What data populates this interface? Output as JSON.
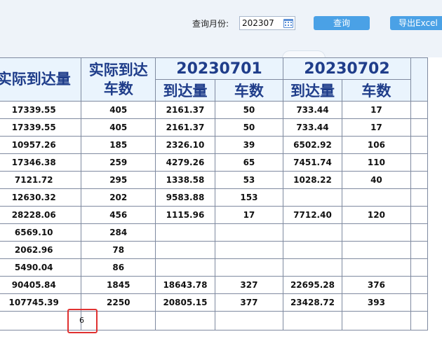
{
  "toolbar": {
    "month_label": "查询月份:",
    "month_value": "202307",
    "query_label": "查询",
    "export_label": "导出Excel"
  },
  "table": {
    "headers": {
      "actual_qty": "实际到达量",
      "actual_trucks_line1": "实际到达",
      "actual_trucks_line2": "车数",
      "dates": [
        "20230701",
        "20230702"
      ],
      "sub_qty": "到达量",
      "sub_trucks": "车数"
    },
    "rows": [
      [
        "17339.55",
        "405",
        "2161.37",
        "50",
        "733.44",
        "17"
      ],
      [
        "17339.55",
        "405",
        "2161.37",
        "50",
        "733.44",
        "17"
      ],
      [
        "10957.26",
        "185",
        "2326.10",
        "39",
        "6502.92",
        "106"
      ],
      [
        "17346.38",
        "259",
        "4279.26",
        "65",
        "7451.74",
        "110"
      ],
      [
        "7121.72",
        "295",
        "1338.58",
        "53",
        "1028.22",
        "40"
      ],
      [
        "12630.32",
        "202",
        "9583.88",
        "153",
        "",
        ""
      ],
      [
        "28228.06",
        "456",
        "1115.96",
        "17",
        "7712.40",
        "120"
      ],
      [
        "6569.10",
        "284",
        "",
        "",
        "",
        ""
      ],
      [
        "2062.96",
        "78",
        "",
        "",
        "",
        ""
      ],
      [
        "5490.04",
        "86",
        "",
        "",
        "",
        ""
      ],
      [
        "90405.84",
        "1845",
        "18643.78",
        "327",
        "22695.28",
        "376"
      ],
      [
        "107745.39",
        "2250",
        "20805.15",
        "377",
        "23428.72",
        "393"
      ]
    ],
    "selected_cell_value": "6"
  }
}
